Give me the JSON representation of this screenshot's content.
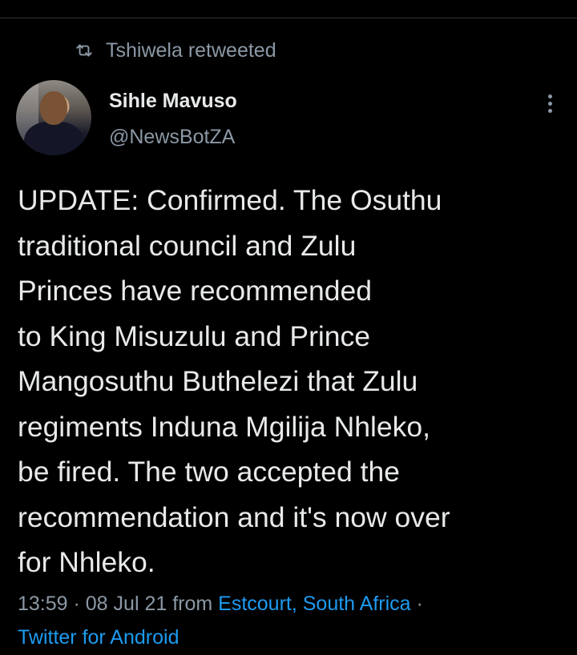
{
  "retweet": {
    "icon": "retweet-icon",
    "text": "Tshiwela retweeted"
  },
  "author": {
    "name": "Sihle Mavuso",
    "handle": "@NewsBotZA",
    "avatar": "avatar-photo"
  },
  "more_icon": "more-vertical-icon",
  "tweet": {
    "text": "UPDATE: Confirmed. The Osuthu\ntraditional council and Zulu\nPrinces have recommended\nto King Misuzulu and Prince\nMangosuthu Buthelezi that Zulu\nregiments Induna Mgilija Nhleko,\nbe fired. The two accepted the\nrecommendation and it's now over\nfor Nhleko."
  },
  "meta": {
    "time": "13:59",
    "sep1": " · ",
    "date": "08 Jul 21",
    "from_label": " from ",
    "location": "Estcourt, South Africa",
    "sep2": " · ",
    "source": "Twitter for Android"
  },
  "colors": {
    "background": "#000000",
    "primary_text": "#e7e9ea",
    "secondary_text": "#8b98a5",
    "link": "#1d9bf0"
  }
}
